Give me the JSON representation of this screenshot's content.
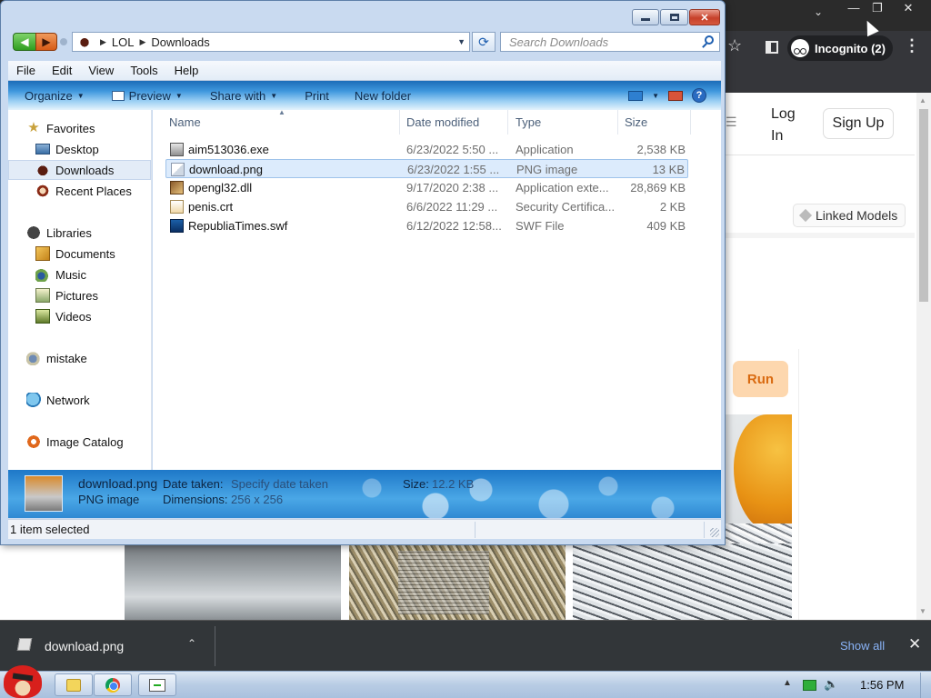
{
  "browser": {
    "incognito_label": "Incognito (2)",
    "page": {
      "login_label": "Log In",
      "signup_label": "Sign Up",
      "linked_models_label": "Linked Models",
      "run_label": "Run"
    },
    "download_bar": {
      "file_name": "download.png",
      "show_all_label": "Show all"
    }
  },
  "explorer": {
    "breadcrumb": [
      "LOL",
      "Downloads"
    ],
    "search_placeholder": "Search Downloads",
    "menu": [
      "File",
      "Edit",
      "View",
      "Tools",
      "Help"
    ],
    "commands": {
      "organize": "Organize",
      "preview": "Preview",
      "share_with": "Share with",
      "print": "Print",
      "new_folder": "New folder"
    },
    "nav": {
      "favorites": "Favorites",
      "desktop": "Desktop",
      "downloads": "Downloads",
      "recent_places": "Recent Places",
      "libraries": "Libraries",
      "documents": "Documents",
      "music": "Music",
      "pictures": "Pictures",
      "videos": "Videos",
      "mistake": "mistake",
      "network": "Network",
      "image_catalog": "Image Catalog"
    },
    "columns": {
      "name": "Name",
      "date_modified": "Date modified",
      "type": "Type",
      "size": "Size"
    },
    "files": [
      {
        "name": "aim513036.exe",
        "date": "6/23/2022 5:50 ...",
        "type": "Application",
        "size": "2,538 KB",
        "icon": "exe-icon"
      },
      {
        "name": "download.png",
        "date": "6/23/2022 1:55 ...",
        "type": "PNG image",
        "size": "13 KB",
        "icon": "png-file-icon"
      },
      {
        "name": "opengl32.dll",
        "date": "9/17/2020 2:38 ...",
        "type": "Application exte...",
        "size": "28,869 KB",
        "icon": "dll-file-icon"
      },
      {
        "name": "penis.crt",
        "date": "6/6/2022 11:29 ...",
        "type": "Security Certifica...",
        "size": "2 KB",
        "icon": "certificate-file-icon"
      },
      {
        "name": "RepubliaTimes.swf",
        "date": "6/12/2022 12:58...",
        "type": "SWF File",
        "size": "409 KB",
        "icon": "swf-file-icon"
      }
    ],
    "selected_file_index": 1,
    "details": {
      "file_name": "download.png",
      "file_type": "PNG image",
      "date_taken_label": "Date taken:",
      "date_taken_value": "Specify date taken",
      "dimensions_label": "Dimensions:",
      "dimensions_value": "256 x 256",
      "size_label": "Size:",
      "size_value": "12.2 KB"
    },
    "status": "1 item selected"
  },
  "taskbar": {
    "clock": "1:56 PM"
  }
}
